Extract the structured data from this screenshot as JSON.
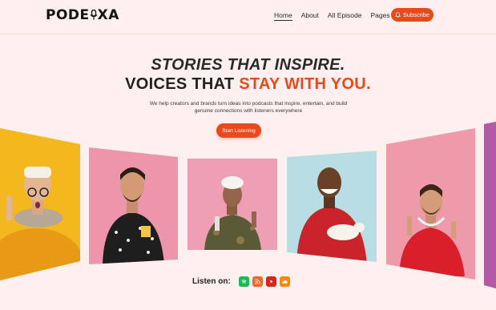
{
  "header": {
    "logo_text_left": "PODE",
    "logo_text_right": "XA",
    "nav": [
      {
        "label": "Home",
        "active": true
      },
      {
        "label": "About"
      },
      {
        "label": "All Episode"
      },
      {
        "label": "Pages",
        "dropdown": true
      }
    ],
    "subscribe_label": "Subscribe"
  },
  "hero": {
    "line1": "STORIES THAT INSPIRE.",
    "line2_prefix": "VOICES THAT ",
    "line2_accent": "STAY WITH YOU.",
    "description": "We help creators and brands turn ideas into podcasts that inspire, entertain, and build genuine connections with listeners everywhere",
    "cta_label": "Start Listening"
  },
  "listen": {
    "label": "Listen on:",
    "platforms": [
      {
        "name": "spotify-icon",
        "color": "#1db954"
      },
      {
        "name": "rss-icon",
        "color": "#f26522"
      },
      {
        "name": "youtube-icon",
        "color": "#d9261c"
      },
      {
        "name": "soundcloud-icon",
        "color": "#ff8800"
      }
    ]
  },
  "colors": {
    "accent": "#e8491d",
    "background": "#fdf0ee"
  }
}
